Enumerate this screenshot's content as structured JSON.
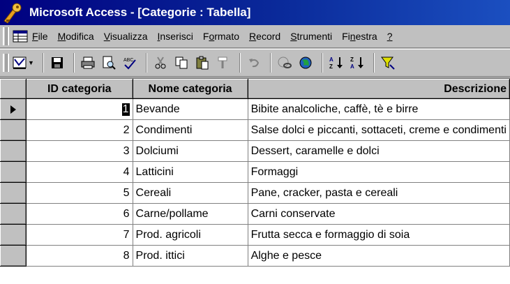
{
  "window": {
    "title": "Microsoft Access - [Categorie : Tabella]"
  },
  "menu": {
    "items": [
      {
        "pre": "",
        "ul": "F",
        "post": "ile"
      },
      {
        "pre": "",
        "ul": "M",
        "post": "odifica"
      },
      {
        "pre": "",
        "ul": "V",
        "post": "isualizza"
      },
      {
        "pre": "",
        "ul": "I",
        "post": "nserisci"
      },
      {
        "pre": "F",
        "ul": "o",
        "post": "rmato"
      },
      {
        "pre": "",
        "ul": "R",
        "post": "ecord"
      },
      {
        "pre": "",
        "ul": "S",
        "post": "trumenti"
      },
      {
        "pre": "Fi",
        "ul": "n",
        "post": "estra"
      },
      {
        "pre": "",
        "ul": "?",
        "post": ""
      }
    ]
  },
  "toolbar": {
    "icons": [
      "view-design-icon",
      "save-icon",
      "print-icon",
      "print-preview-icon",
      "spelling-icon",
      "cut-icon",
      "copy-icon",
      "paste-icon",
      "format-painter-icon",
      "undo-icon",
      "insert-hyperlink-icon",
      "web-toolbar-icon",
      "sort-ascending-icon",
      "sort-descending-icon",
      "filter-by-selection-icon"
    ]
  },
  "table": {
    "columns": [
      "ID categoria",
      "Nome categoria",
      "Descrizione"
    ],
    "rows": [
      {
        "id": "1",
        "name": "Bevande",
        "desc": "Bibite analcoliche, caffè, tè e birre"
      },
      {
        "id": "2",
        "name": "Condimenti",
        "desc": "Salse dolci e piccanti, sottaceti, creme e condimenti"
      },
      {
        "id": "3",
        "name": "Dolciumi",
        "desc": "Dessert, caramelle e dolci"
      },
      {
        "id": "4",
        "name": "Latticini",
        "desc": "Formaggi"
      },
      {
        "id": "5",
        "name": "Cereali",
        "desc": "Pane, cracker, pasta e cereali"
      },
      {
        "id": "6",
        "name": "Carne/pollame",
        "desc": "Carni conservate"
      },
      {
        "id": "7",
        "name": "Prod. agricoli",
        "desc": "Frutta secca e formaggio di soia"
      },
      {
        "id": "8",
        "name": "Prod. ittici",
        "desc": "Alghe e pesce"
      }
    ],
    "current_row": 0
  }
}
